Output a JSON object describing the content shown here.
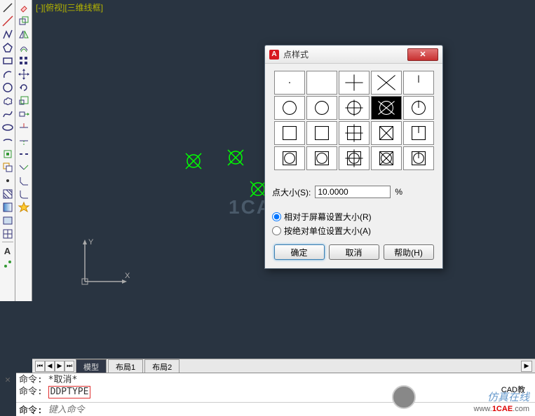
{
  "view_label": "[-][俯视][三维线框]",
  "toolbar1": [
    "line",
    "multiline",
    "polyline",
    "polygon",
    "rectangle",
    "arc",
    "circle",
    "revcloud",
    "spline",
    "ellipse",
    "ellipse-arc",
    "insert",
    "hatch",
    "gradient",
    "region",
    "table",
    "text",
    "point"
  ],
  "toolbar2": [
    "snap",
    "grid",
    "ortho",
    "polar",
    "osnap",
    "3dosnap",
    "otrack",
    "ducs",
    "dyn",
    "lwt",
    "tpy",
    "qp",
    "sc"
  ],
  "dialog": {
    "title": "点样式",
    "size_label": "点大小(S):",
    "size_value": "10.0000",
    "size_unit": "%",
    "radio1": "相对于屏幕设置大小(R)",
    "radio2": "按绝对单位设置大小(A)",
    "ok": "确定",
    "cancel": "取消",
    "help": "帮助(H)"
  },
  "point_styles_selected_index": 8,
  "tabs": {
    "model": "模型",
    "layout1": "布局1",
    "layout2": "布局2"
  },
  "cmd": {
    "line1_label": "命令:",
    "line1_value": "*取消*",
    "line2_label": "命令:",
    "line2_value": "DDPTYPE",
    "input_label": "命令:",
    "input_placeholder": "键入命令"
  },
  "watermark_center": "1CAE",
  "bottom_brand": {
    "line1": "仿真在线",
    "prefix": "www.",
    "mid": "1CAE",
    "suffix": ".com",
    "sticker": "CAD教"
  }
}
